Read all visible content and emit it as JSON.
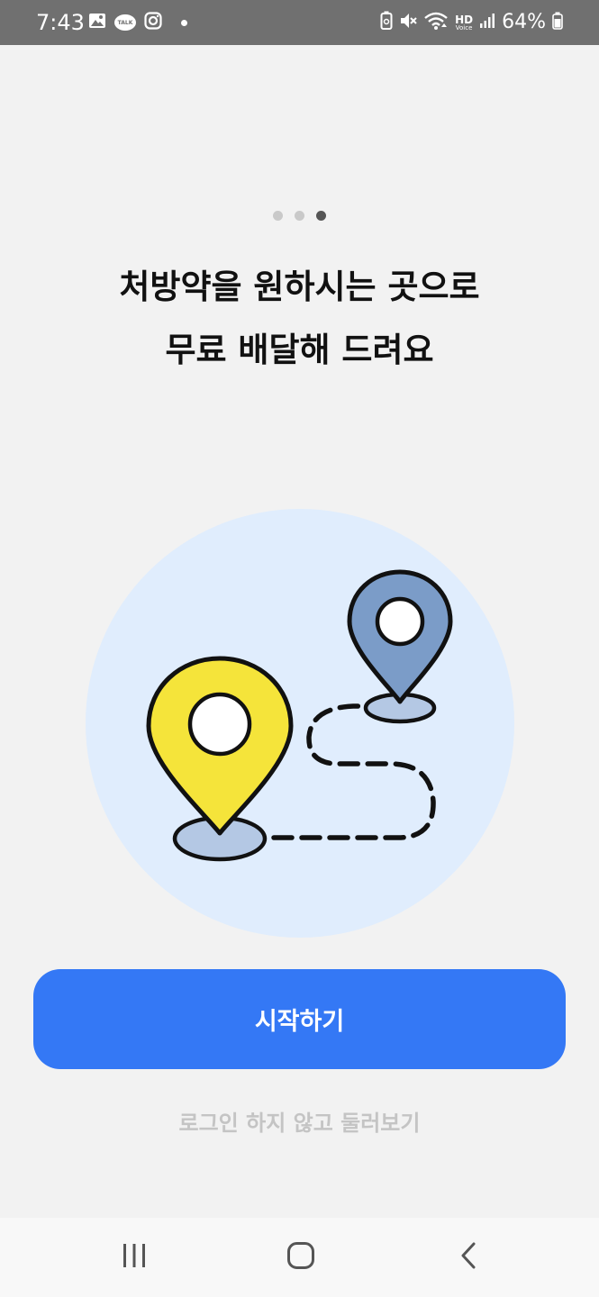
{
  "status_bar": {
    "time": "7:43",
    "battery_percent": "64%",
    "left_icons": [
      "gallery-icon",
      "kakaotalk-icon",
      "instagram-icon",
      "notification-dot-icon"
    ],
    "talk_label": "TALK",
    "hd_label": "HD",
    "voice_label": "Voice",
    "right_icons": [
      "battery-saver-icon",
      "mute-icon",
      "wifi-icon",
      "hd-voice-icon",
      "signal-icon",
      "battery-icon"
    ]
  },
  "onboarding": {
    "page_count": 3,
    "active_page": 3,
    "headline_line1": "처방약을 원하시는 곳으로",
    "headline_line2": "무료 배달해 드려요",
    "illustration_icons": [
      "yellow-location-pin-icon",
      "blue-location-pin-icon",
      "dashed-route-icon"
    ],
    "colors": {
      "yellow_pin": "#f5e43a",
      "blue_pin": "#7b9cc8",
      "circle_bg": "#e0edfd",
      "pin_base": "#b4c8e4"
    }
  },
  "actions": {
    "start_label": "시작하기",
    "browse_label": "로그인 하지 않고 둘러보기",
    "primary_color": "#3478f5"
  },
  "nav_bar": {
    "icons": [
      "recent-apps-icon",
      "home-icon",
      "back-icon"
    ]
  }
}
